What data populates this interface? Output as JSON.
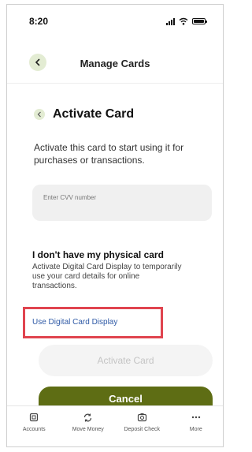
{
  "status_bar": {
    "time": "8:20"
  },
  "header": {
    "title": "Manage Cards",
    "back_icon": "chevron-left-icon"
  },
  "section": {
    "title": "Activate Card",
    "description": "Activate this card to start using it for purchases or transactions.",
    "cvv_placeholder": "Enter CVV number"
  },
  "no_card": {
    "title": "I don't have my physical card",
    "description": "Activate Digital Card Display to temporarily use your card details for online transactions.",
    "link_label": "Use Digital Card Display"
  },
  "buttons": {
    "activate_label": "Activate Card",
    "cancel_label": "Cancel"
  },
  "tab_bar": {
    "items": [
      {
        "label": "Accounts",
        "icon": "accounts-icon"
      },
      {
        "label": "Move Money",
        "icon": "move-money-icon"
      },
      {
        "label": "Deposit Check",
        "icon": "camera-icon"
      },
      {
        "label": "More",
        "icon": "more-icon"
      }
    ]
  },
  "colors": {
    "accent": "#5e6d14",
    "accent_light": "#e3ecd3",
    "link": "#2f5aa6",
    "highlight": "#e0444f"
  }
}
